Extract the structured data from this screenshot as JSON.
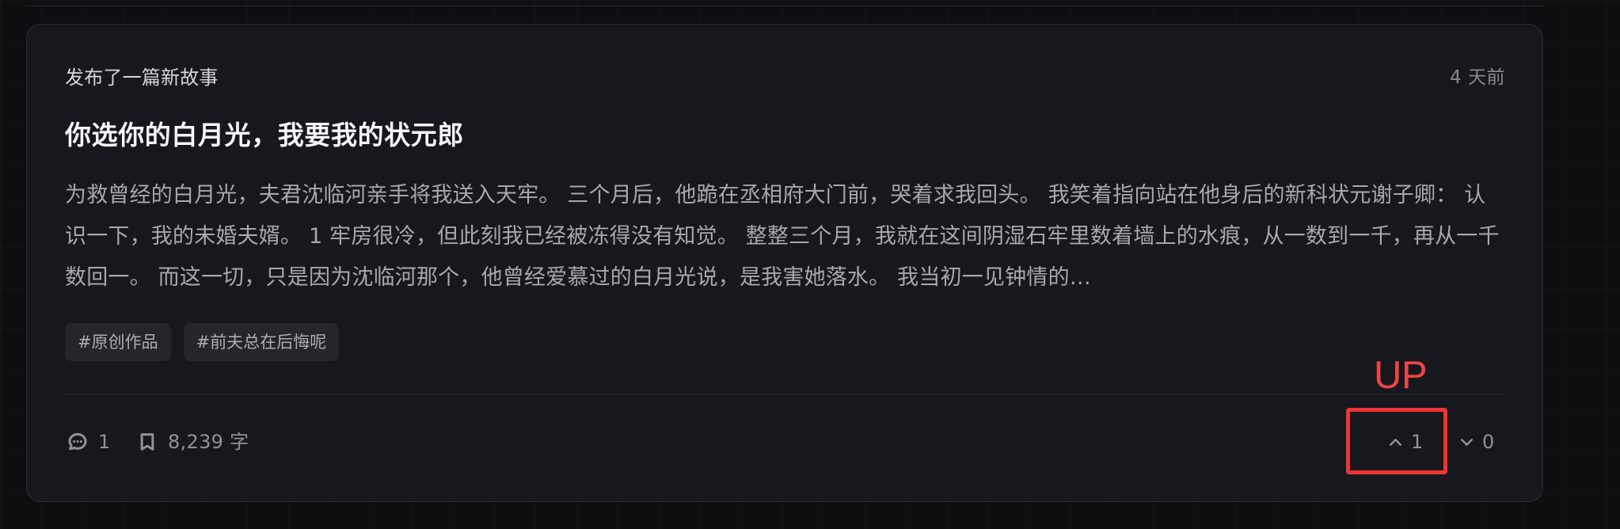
{
  "story_card": {
    "meta": "发布了一篇新故事",
    "time": "4 天前",
    "title": "你选你的白月光，我要我的状元郎",
    "summary": "为救曾经的白月光，夫君沈临河亲手将我送入天牢。 三个月后，他跪在丞相府大门前，哭着求我回头。 我笑着指向站在他身后的新科状元谢子卿： 认识一下，我的未婚夫婿。 1 牢房很冷，但此刻我已经被冻得没有知觉。 整整三个月，我就在这间阴湿石牢里数着墙上的水痕，从一数到一千，再从一千数回一。 而这一切，只是因为沈临河那个，他曾经爱慕过的白月光说，是我害她落水。 我当初一见钟情的…",
    "tags": [
      "#原创作品",
      "#前夫总在后悔呢"
    ],
    "stats": {
      "comments": "1",
      "word_count": "8,239 字"
    },
    "votes": {
      "up": "1",
      "down": "0"
    }
  },
  "annotation": {
    "label": "UP",
    "color": "#ee3434"
  },
  "icons": {
    "comments": "comment-bubble-icon",
    "words": "bookmark-icon",
    "up": "chevron-up-icon",
    "down": "chevron-down-icon"
  }
}
